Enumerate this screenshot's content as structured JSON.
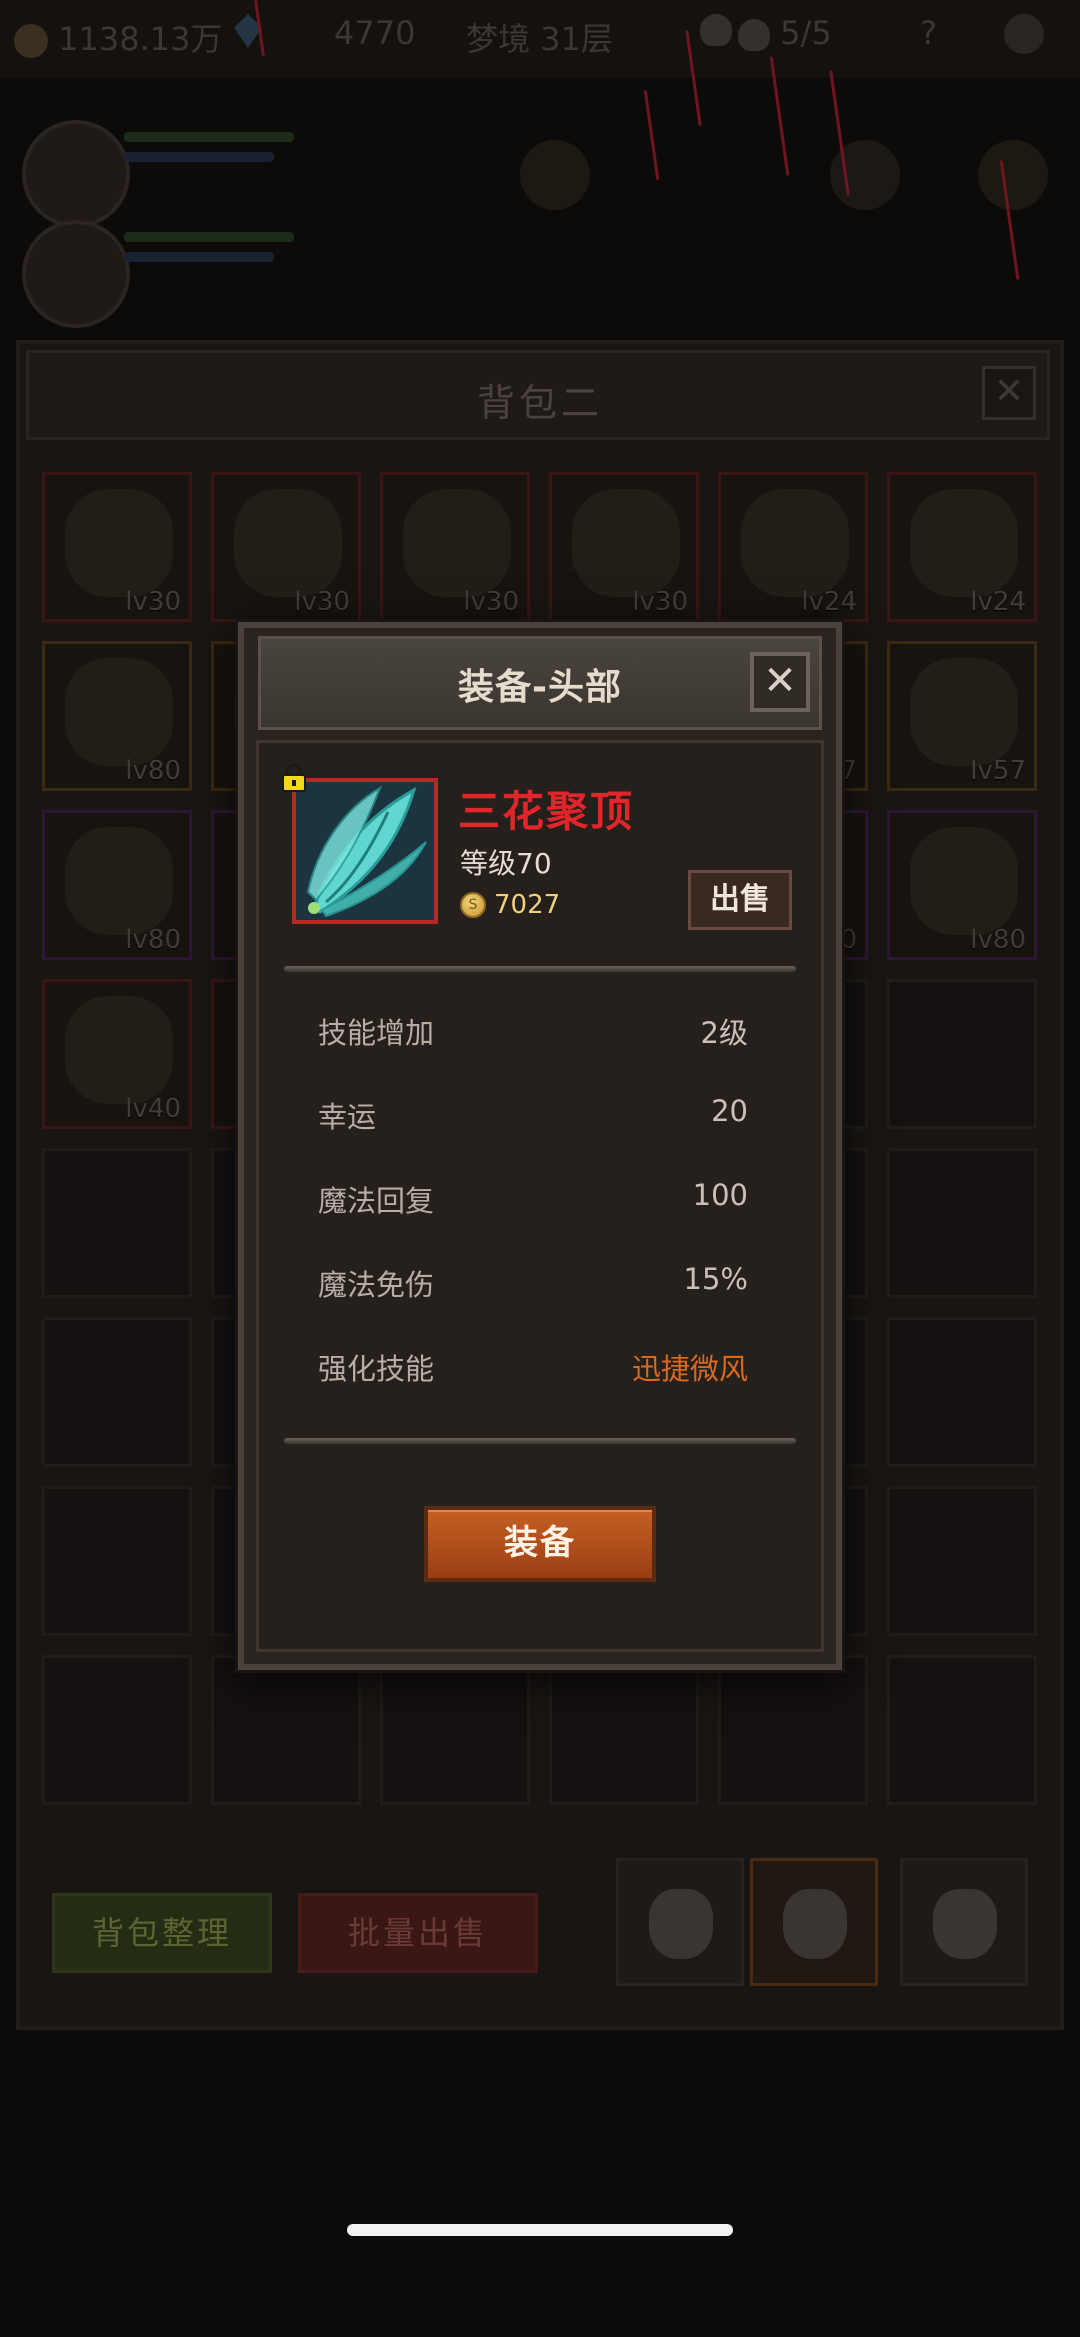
{
  "topbar": {
    "gold": "1138.13万",
    "gems": "4770",
    "dream_level": "梦境 31层",
    "skull_count": "5/5",
    "help": "?"
  },
  "bag": {
    "title": "背包二",
    "close": "✕",
    "slots": [
      {
        "level": "lv30",
        "icon": "ring-icon",
        "rarity": "red"
      },
      {
        "level": "lv30",
        "icon": "boots-icon",
        "rarity": "red"
      },
      {
        "level": "lv30",
        "icon": "hood-icon",
        "rarity": "red"
      },
      {
        "level": "lv30",
        "icon": "hood-icon",
        "rarity": "red"
      },
      {
        "level": "lv24",
        "icon": "amulet-icon",
        "rarity": "red"
      },
      {
        "level": "lv24",
        "icon": "boots-icon",
        "rarity": "red"
      },
      {
        "level": "lv80",
        "icon": "ring-icon",
        "rarity": "gold"
      },
      {
        "level": "",
        "icon": "ring-icon",
        "rarity": "gold"
      },
      {
        "level": "",
        "icon": "",
        "rarity": "gold"
      },
      {
        "level": "",
        "icon": "",
        "rarity": "gold"
      },
      {
        "level": "7",
        "icon": "",
        "rarity": "gold"
      },
      {
        "level": "lv57",
        "icon": "armor-icon",
        "rarity": "gold"
      },
      {
        "level": "lv80",
        "icon": "amulet-icon",
        "rarity": "purple"
      },
      {
        "level": "",
        "icon": "",
        "rarity": "purple"
      },
      {
        "level": "",
        "icon": "",
        "rarity": "purple"
      },
      {
        "level": "",
        "icon": "",
        "rarity": "purple"
      },
      {
        "level": "0",
        "icon": "",
        "rarity": "purple"
      },
      {
        "level": "lv80",
        "icon": "boots-icon",
        "rarity": "purple"
      },
      {
        "level": "lv40",
        "icon": "cloak-icon",
        "rarity": "red"
      },
      {
        "level": "",
        "icon": "",
        "rarity": "red"
      }
    ],
    "sort_button": "背包整理",
    "bulk_sell_button": "批量出售"
  },
  "modal": {
    "title": "装备-头部",
    "close": "✕",
    "item": {
      "name": "三花聚顶",
      "level_text": "等级70",
      "price": "7027",
      "coin_symbol": "S",
      "icon": "feather-wing-icon",
      "locked": true
    },
    "sell_button": "出售",
    "stats": [
      {
        "label": "技能增加",
        "value": "2级"
      },
      {
        "label": "幸运",
        "value": "20"
      },
      {
        "label": "魔法回复",
        "value": "100"
      },
      {
        "label": "魔法免伤",
        "value": "15%"
      },
      {
        "label": "强化技能",
        "value": "迅捷微风"
      }
    ],
    "equip_button": "装备"
  },
  "colors": {
    "item_name": "#e0262a",
    "special_value": "#d9691e",
    "equip_button": "#c65f22",
    "price": "#f0d07a"
  }
}
